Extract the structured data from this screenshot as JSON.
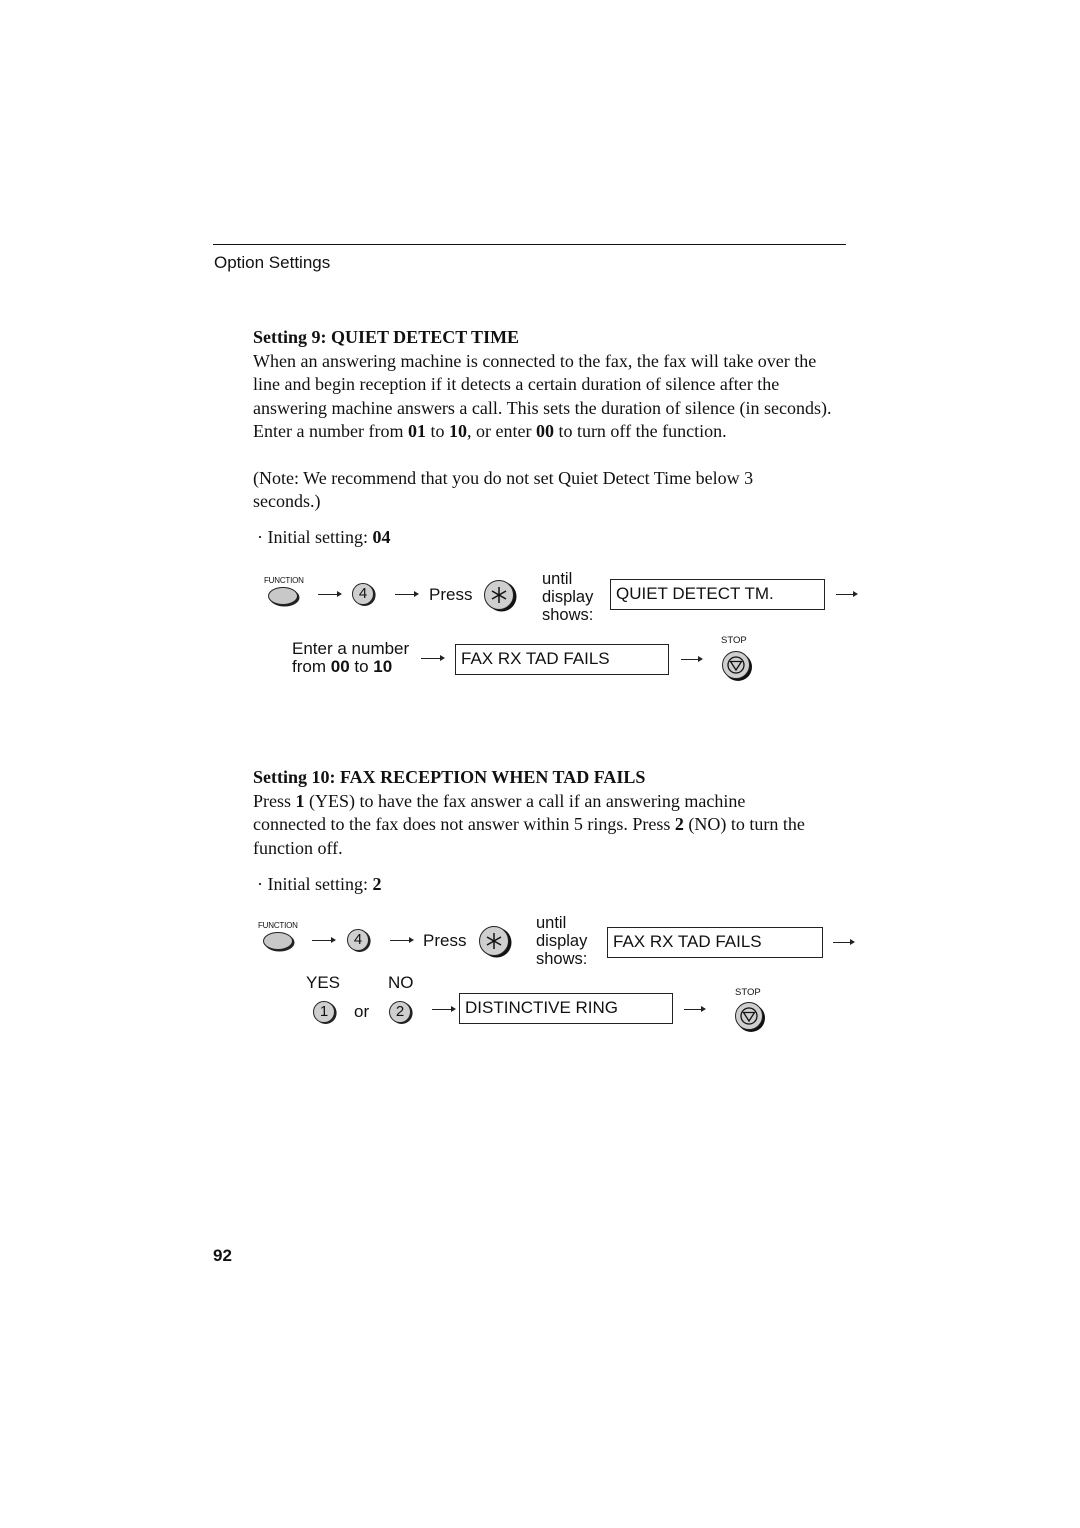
{
  "header": {
    "section_title": "Option Settings"
  },
  "setting9": {
    "heading": "Setting 9: QUIET DETECT TIME",
    "paragraph": {
      "p1": "When an answering machine is connected to the fax, the fax will take over the line and begin reception if it detects a certain duration of silence after the answering machine answers a call. This sets the duration of silence (in seconds). Enter a number from ",
      "b1": "01",
      "p2": " to ",
      "b2": "10",
      "p3": ", or enter ",
      "b3": "00",
      "p4": " to turn off the function."
    },
    "note": "(Note: We recommend that you do not set Quiet Detect Time below 3 seconds.)",
    "initial_label": "Initial setting: ",
    "initial_value": "04",
    "diagram": {
      "function_label": "FUNCTION",
      "key_digit": "4",
      "press_label": "Press",
      "star_key_icon": "star-key-icon",
      "until": "until",
      "display": "display",
      "shows": "shows:",
      "display_text_1": "QUIET DETECT TM.",
      "enter_line1": "Enter a number",
      "enter_from": "from ",
      "enter_b1": "00",
      "enter_to": " to ",
      "enter_b2": "10",
      "display_text_2": "FAX RX TAD FAILS",
      "stop_label": "STOP"
    }
  },
  "setting10": {
    "heading": "Setting 10: FAX RECEPTION WHEN TAD FAILS",
    "paragraph": {
      "p1": "Press ",
      "b1": "1",
      "p2": " (YES) to have the fax answer a call if an answering machine connected to the fax does not answer within 5 rings. Press ",
      "b2": "2",
      "p3": " (NO) to turn the function off."
    },
    "initial_label": "Initial setting: ",
    "initial_value": "2",
    "diagram": {
      "function_label": "FUNCTION",
      "key_digit": "4",
      "press_label": "Press",
      "until": "until",
      "display": "display",
      "shows": "shows:",
      "display_text_1": "FAX RX TAD FAILS",
      "yes_label": "YES",
      "no_label": "NO",
      "key_yes": "1",
      "or_label": "or",
      "key_no": "2",
      "display_text_2": "DISTINCTIVE RING",
      "stop_label": "STOP"
    }
  },
  "footer": {
    "page_number": "92"
  }
}
